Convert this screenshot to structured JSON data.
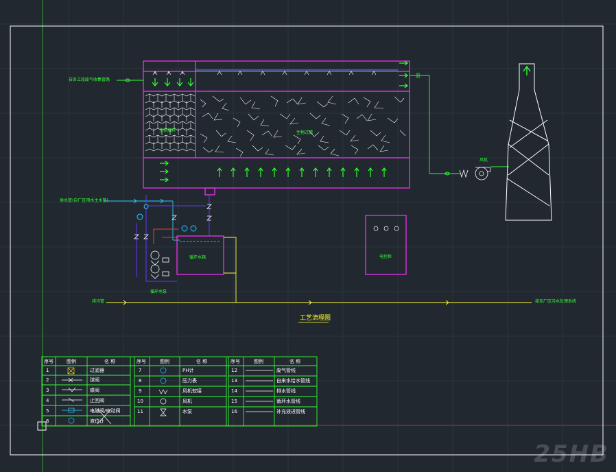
{
  "diagram": {
    "title": "工艺流程图",
    "labels": {
      "exhaust_in": "自各工段废气收集管路",
      "packing_left": "生物填料",
      "packing_main": "生物过滤",
      "water_in": "供水管(自厂区用水主水管)",
      "tank": "循环水箱",
      "pump": "循环水泵",
      "fan": "风机",
      "panel": "电控柜",
      "drain": "排污管",
      "sewer": "接至厂区污水处理系统"
    }
  },
  "legend": {
    "headers": [
      "序号",
      "图例",
      "名 称"
    ],
    "rows": [
      {
        "n": "1",
        "name": "过滤器"
      },
      {
        "n": "2",
        "name": "球阀"
      },
      {
        "n": "3",
        "name": "蝶阀"
      },
      {
        "n": "4",
        "name": "止回阀"
      },
      {
        "n": "5",
        "name": "电磁阀/电动阀"
      },
      {
        "n": "6",
        "name": "液位计"
      },
      {
        "n": "7",
        "name": "PH计"
      },
      {
        "n": "8",
        "name": "压力表"
      },
      {
        "n": "9",
        "name": "风机软接"
      },
      {
        "n": "10",
        "name": "风机"
      },
      {
        "n": "11",
        "name": "水泵"
      },
      {
        "n": "12",
        "name": "废气管线"
      },
      {
        "n": "13",
        "name": "自来水给水管线"
      },
      {
        "n": "14",
        "name": "排水管线"
      },
      {
        "n": "15",
        "name": "循环水管线"
      },
      {
        "n": "16",
        "name": "补充液进管线"
      }
    ]
  },
  "watermark": "25HB",
  "colors": {
    "bg": "#212830",
    "frame": "#ffffff",
    "equipment": "#ff33ff",
    "gas": "#33ff33",
    "water": "#33ccff",
    "drain": "#ffff33",
    "circ": "#6633ff"
  }
}
